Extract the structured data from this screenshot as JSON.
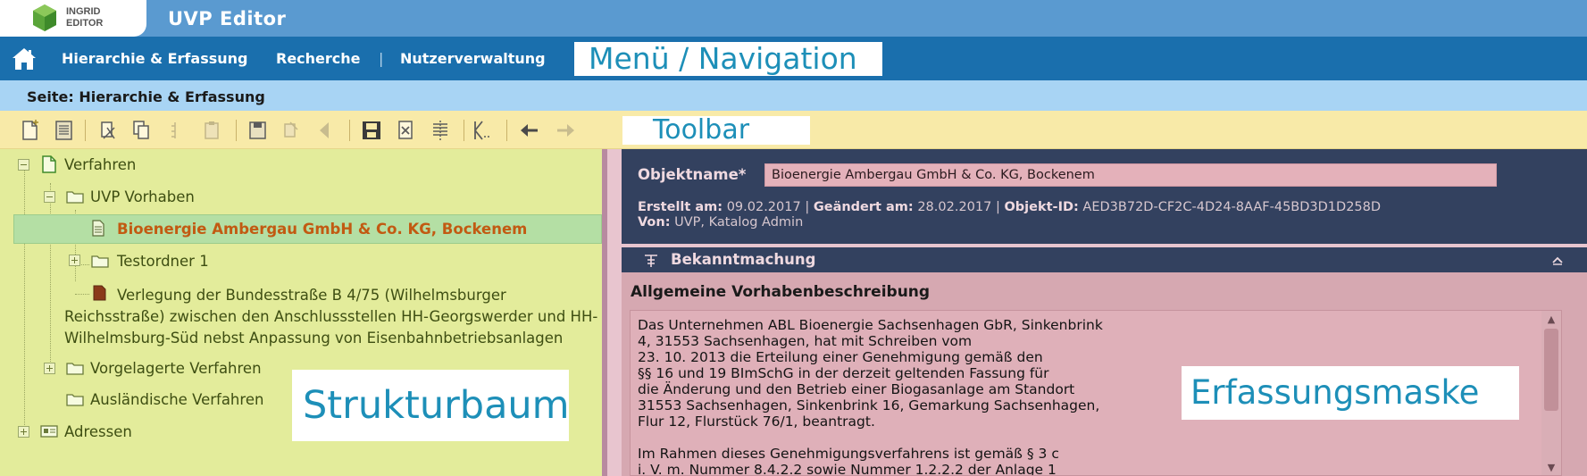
{
  "app": {
    "logo_line1": "INGRID",
    "logo_line2": "EDITOR",
    "title": "UVP Editor"
  },
  "nav": {
    "items": [
      "Hierarchie & Erfassung",
      "Recherche",
      "Nutzerverwaltung"
    ],
    "separator": "|",
    "overlay_label": "Menü / Navigation"
  },
  "page": {
    "label": "Seite: Hierarchie & Erfassung"
  },
  "toolbar": {
    "overlay_label": "Toolbar",
    "icons": [
      "new-document-icon",
      "new-folder-icon",
      "cut-icon",
      "copy-icon",
      "copy-tree-icon",
      "paste-icon",
      "save-icon",
      "discard-icon",
      "back-icon",
      "save-final-icon",
      "delete-icon",
      "move-icon",
      "compare-icon",
      "undo-arrow-icon",
      "redo-arrow-icon"
    ]
  },
  "tree": {
    "overlay_label": "Strukturbaum",
    "root": "Verfahren",
    "uvp_vorhaben": "UVP Vorhaben",
    "selected": "Bioenergie Ambergau GmbH & Co. KG, Bockenem",
    "testordner": "Testordner 1",
    "verlegung_line1": "Verlegung der Bundesstraße B 4/75 (Wilhelmsburger",
    "verlegung_line2": "Reichsstraße) zwischen den Anschlussstellen HH-Georgswerder und HH-",
    "verlegung_line3": "Wilhelmsburg-Süd nebst Anpassung von Eisenbahnbetriebsanlagen",
    "vorgelagerte": "Vorgelagerte Verfahren",
    "auslaendische": "Ausländische Verfahren",
    "adressen": "Adressen"
  },
  "form": {
    "overlay_label": "Erfassungsmaske",
    "objektname_label": "Objektname*",
    "objektname_value": "Bioenergie Ambergau GmbH & Co. KG, Bockenem",
    "erstellt_label": "Erstellt am:",
    "erstellt_value": "09.02.2017",
    "geaendert_label": "Geändert am:",
    "geaendert_value": "28.02.2017",
    "objekt_id_label": "Objekt-ID:",
    "objekt_id_value": "AED3B72D-CF2C-4D24-8AAF-45BD3D1D258D",
    "von_label": "Von:",
    "von_value": "UVP, Katalog Admin",
    "section_title": "Bekanntmachung",
    "field_label": "Allgemeine Vorhabenbeschreibung",
    "description": "Das Unternehmen ABL Bioenergie Sachsenhagen GbR, Sinkenbrink\n4, 31553 Sachsenhagen, hat mit Schreiben vom\n23. 10. 2013 die Erteilung einer Genehmigung gemäß den\n§§ 16 und 19 BImSchG in der derzeit geltenden Fassung für\ndie Änderung und den Betrieb einer Biogasanlage am Standort\n31553 Sachsenhagen, Sinkenbrink 16, Gemarkung Sachsenhagen,\nFlur 12, Flurstück 76/1, beantragt.\n\nIm Rahmen dieses Genehmigungsverfahrens ist gemäß § 3 c\ni. V. m. Nummer 8.4.2.2 sowie Nummer 1.2.2.2 der Anlage 1"
  },
  "colors": {
    "title_bar": "#5a9ad0",
    "nav_bar": "#1a6fad",
    "page_bar": "#a8d4f4",
    "toolbar": "#f8eaa8",
    "tree_bg": "#e3ec9b",
    "tree_selected_text": "#c25a12",
    "form_header": "#33415f",
    "form_body": "#d6a8b1",
    "overlay_text": "#1d8fb8"
  }
}
